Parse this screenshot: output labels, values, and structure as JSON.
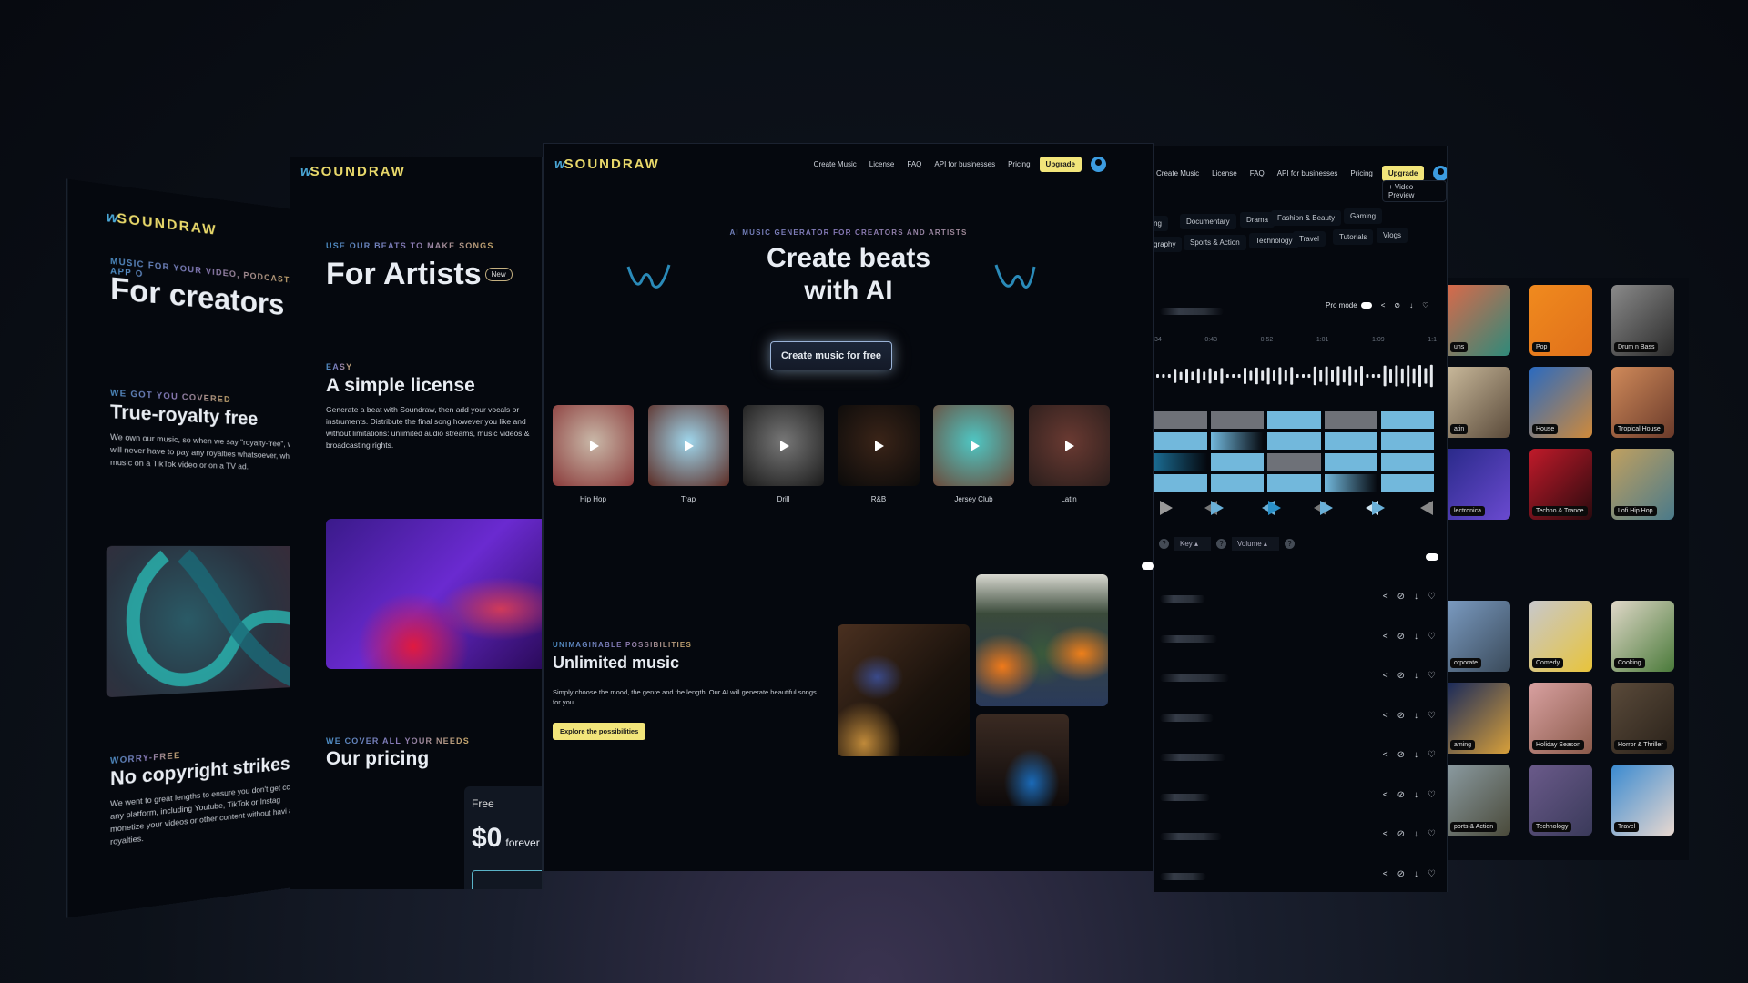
{
  "brand": {
    "name": "SOUNDRAW",
    "logo_mark": "w"
  },
  "nav": {
    "items": [
      "Create Music",
      "License",
      "FAQ",
      "API for businesses",
      "Pricing"
    ],
    "upgrade": "Upgrade",
    "video_preview": "+ Video Preview"
  },
  "creators": {
    "eyebrow": "MUSIC FOR YOUR VIDEO, PODCAST, APP O",
    "title": "For creators",
    "s1_eyebrow": "WE GOT YOU COVERED",
    "s1_title": "True-royalty free",
    "s1_body": "We own our music, so when we say \"royalty-free\", we will never have to pay any royalties whatsoever, wh the music on a TikTok video or on a TV ad.",
    "s2_eyebrow": "WORRY-FREE",
    "s2_title": "No copyright strikes",
    "s2_body": "We went to great lengths to ensure you don't get cc on any platform, including Youtube, TikTok or Instag monetize your videos or other content without havi any royalties."
  },
  "artists": {
    "eyebrow": "USE OUR BEATS TO MAKE SONGS",
    "title": "For Artists",
    "badge": "New",
    "s1_eyebrow": "EASY",
    "s1_title": "A simple license",
    "s1_body": "Generate a beat with Soundraw, then add your vocals or instruments. Distribute the final song however you like and without limitations: unlimited audio streams, music videos & broadcasting rights.",
    "s2_eyebrow": "WE COVER ALL YOUR NEEDS",
    "s2_title": "Our pricing",
    "plan_name": "Free",
    "plan_price": "$0",
    "plan_period": "forever"
  },
  "hero": {
    "eyebrow": "AI MUSIC GENERATOR FOR CREATORS AND ARTISTS",
    "title_line1": "Create beats",
    "title_line2": "with AI",
    "cta": "Create music for free",
    "genres": [
      {
        "label": "Hip Hop",
        "c1": "#c9b8a8",
        "c2": "#8a3a3a"
      },
      {
        "label": "Trap",
        "c1": "#9fd6ec",
        "c2": "#5b2a22"
      },
      {
        "label": "Drill",
        "c1": "#777",
        "c2": "#1a1a1a"
      },
      {
        "label": "R&B",
        "c1": "#3a2418",
        "c2": "#0a0a0a"
      },
      {
        "label": "Jersey Club",
        "c1": "#4fc7c4",
        "c2": "#6b4a3a"
      },
      {
        "label": "Latin",
        "c1": "#6a3a32",
        "c2": "#2a1e1c"
      }
    ],
    "section_eyebrow": "UNIMAGINABLE POSSIBILITIES",
    "section_title": "Unlimited music",
    "section_body": "Simply choose the mood, the genre and the length. Our AI will generate beautiful songs for you.",
    "section_cta": "Explore the possibilities"
  },
  "editor": {
    "tags_row1": [
      "ng",
      "Documentary",
      "Drama",
      "Fashion & Beauty",
      "Gaming"
    ],
    "tags_row2": [
      "graphy",
      "Sports & Action",
      "Technology",
      "Travel",
      "Tutorials",
      "Vlogs"
    ],
    "pro_mode": "Pro mode",
    "timeline": [
      "34",
      "0:43",
      "0:52",
      "1:01",
      "1:09",
      "1:1"
    ],
    "key_label": "Key",
    "volume_label": "Volume",
    "track_count": 8
  },
  "categories": [
    {
      "label": "uns",
      "c1": "#d9694a",
      "c2": "#2e8a7a"
    },
    {
      "label": "Pop",
      "c1": "#f08a1e",
      "c2": "#e0701a"
    },
    {
      "label": "Drum n Bass",
      "c1": "#8a8a8a",
      "c2": "#2a2a2a"
    },
    {
      "label": "atin",
      "c1": "#c8b89a",
      "c2": "#5a4a3a"
    },
    {
      "label": "House",
      "c1": "#2a6ac0",
      "c2": "#d08a3a"
    },
    {
      "label": "Tropical House",
      "c1": "#d08a5a",
      "c2": "#6a3a2a"
    },
    {
      "label": "lectronica",
      "c1": "#2a2a8a",
      "c2": "#6a4ad0"
    },
    {
      "label": "Techno & Trance",
      "c1": "#c01a2a",
      "c2": "#2a0a0e"
    },
    {
      "label": "Lofi Hip Hop",
      "c1": "#c0a060",
      "c2": "#4a7a8a"
    },
    {
      "label": "orporate",
      "c1": "#7a9ac0",
      "c2": "#3a4a5a"
    },
    {
      "label": "Comedy",
      "c1": "#c8c8cc",
      "c2": "#e8c43a"
    },
    {
      "label": "Cooking",
      "c1": "#e0d8c8",
      "c2": "#4a7a3a"
    },
    {
      "label": "aming",
      "c1": "#1a2a5a",
      "c2": "#d8a03a"
    },
    {
      "label": "Holiday Season",
      "c1": "#d8a0a0",
      "c2": "#8a5a4a"
    },
    {
      "label": "Horror & Thriller",
      "c1": "#5a4a3a",
      "c2": "#2a221a"
    },
    {
      "label": "ports & Action",
      "c1": "#8a9aa0",
      "c2": "#4a4a3a"
    },
    {
      "label": "Technology",
      "c1": "#6a5a8a",
      "c2": "#3a3a5a"
    },
    {
      "label": "Travel",
      "c1": "#3a8ad0",
      "c2": "#e8d8d0"
    }
  ]
}
